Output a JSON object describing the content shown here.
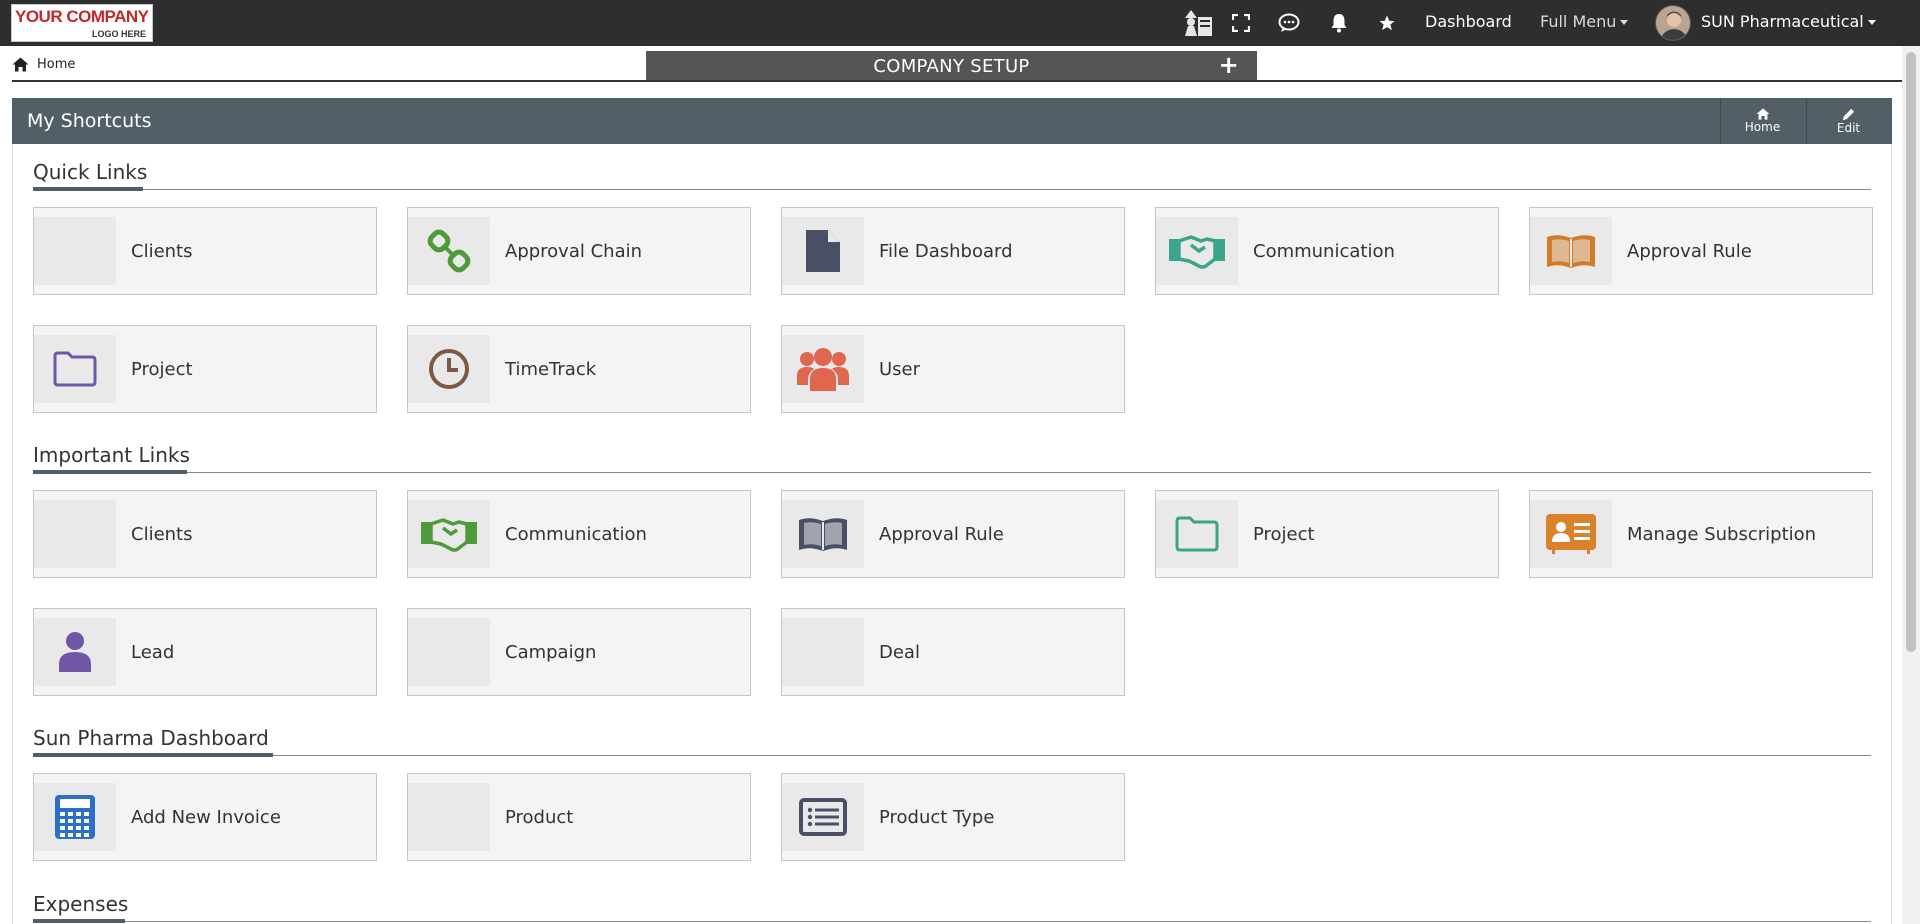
{
  "logo": {
    "main": "YOUR COMPANY",
    "sub": "LOGO HERE"
  },
  "topnav": {
    "icons": [
      "wizard-icon",
      "fullscreen-icon",
      "chat-icon",
      "bell-icon",
      "star-icon"
    ],
    "dashboard": "Dashboard",
    "full_menu": "Full Menu",
    "user_name": "SUN Pharmaceutical"
  },
  "breadcrumb": {
    "home": "Home"
  },
  "company_bar": {
    "title": "COMPANY SETUP",
    "add": "+"
  },
  "panel": {
    "title": "My Shortcuts",
    "home_btn": "Home",
    "edit_btn": "Edit"
  },
  "sections": [
    {
      "title": "Quick Links",
      "tiles": [
        {
          "label": "Clients",
          "icon": "none",
          "color": ""
        },
        {
          "label": "Approval Chain",
          "icon": "link-icon",
          "color": "#4e9a3a"
        },
        {
          "label": "File Dashboard",
          "icon": "file-icon",
          "color": "#4a4f66"
        },
        {
          "label": "Communication",
          "icon": "handshake-icon",
          "color": "#3aa58a"
        },
        {
          "label": "Approval Rule",
          "icon": "book-icon",
          "color": "#d07a2a"
        },
        {
          "label": "Project",
          "icon": "folder-icon",
          "color": "#6f57a6"
        },
        {
          "label": "TimeTrack",
          "icon": "clock-icon",
          "color": "#7a5a44"
        },
        {
          "label": "User",
          "icon": "users-icon",
          "color": "#e06650"
        }
      ]
    },
    {
      "title": "Important Links",
      "tiles": [
        {
          "label": "Clients",
          "icon": "none",
          "color": ""
        },
        {
          "label": "Communication",
          "icon": "handshake-icon",
          "color": "#4f9a3a"
        },
        {
          "label": "Approval Rule",
          "icon": "book-icon",
          "color": "#4a4f66"
        },
        {
          "label": "Project",
          "icon": "folder-icon",
          "color": "#3aa58a"
        },
        {
          "label": "Manage Subscription",
          "icon": "id-card-icon",
          "color": "#d9822b"
        },
        {
          "label": "Lead",
          "icon": "user-icon",
          "color": "#6f57a6"
        },
        {
          "label": "Campaign",
          "icon": "none",
          "color": ""
        },
        {
          "label": "Deal",
          "icon": "none",
          "color": ""
        }
      ]
    },
    {
      "title": "Sun Pharma Dashboard",
      "tiles": [
        {
          "label": "Add New Invoice",
          "icon": "calculator-icon",
          "color": "#2a6fc9"
        },
        {
          "label": "Product",
          "icon": "none",
          "color": ""
        },
        {
          "label": "Product Type",
          "icon": "list-icon",
          "color": "#4a4f66"
        }
      ]
    },
    {
      "title": "Expenses",
      "tiles": []
    }
  ]
}
